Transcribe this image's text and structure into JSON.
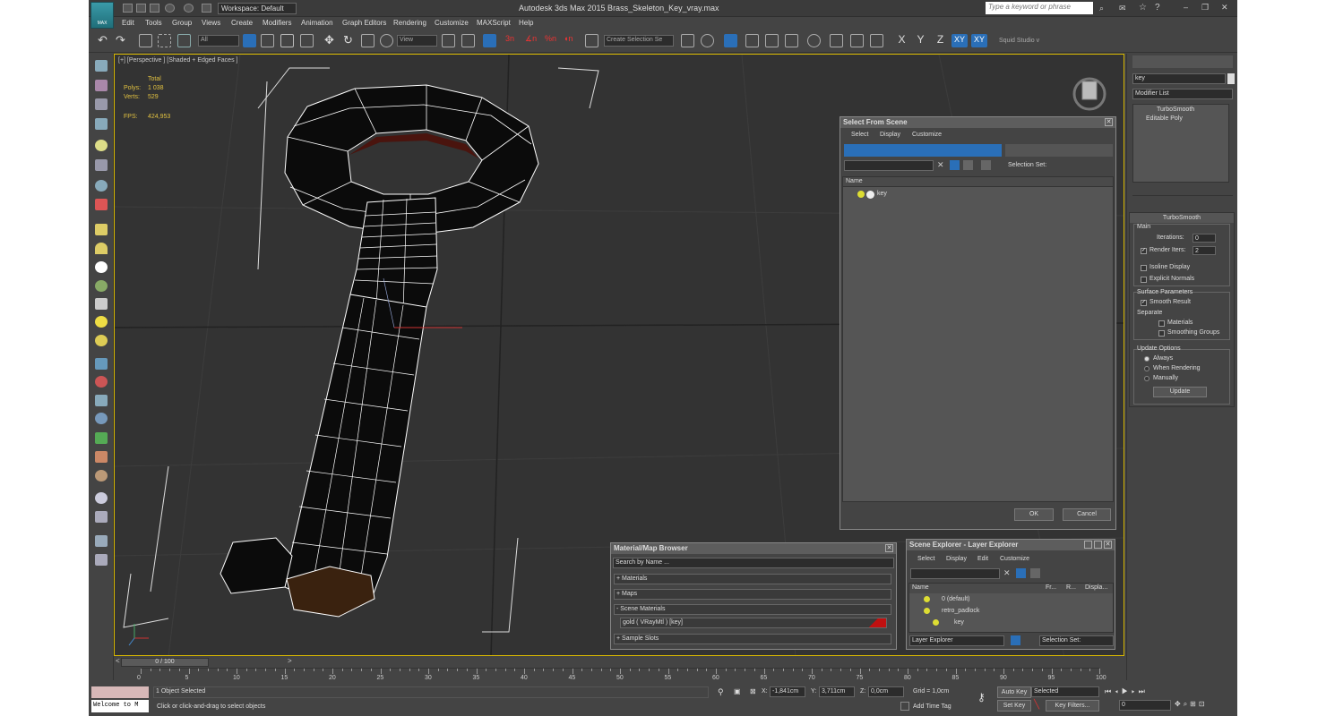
{
  "app": {
    "logo_label": "MAX",
    "workspace": "Workspace: Default",
    "title": "Autodesk 3ds Max  2015      Brass_Skeleton_Key_vray.max",
    "search_placeholder": "Type a keyword or phrase"
  },
  "menu": [
    "Edit",
    "Tools",
    "Group",
    "Views",
    "Create",
    "Modifiers",
    "Animation",
    "Graph Editors",
    "Rendering",
    "Customize",
    "MAXScript",
    "Help"
  ],
  "toolbar": {
    "filter": "All",
    "ref_coord": "View",
    "selection_set": "Create Selection Se",
    "axes": [
      "X",
      "Y",
      "Z",
      "XY",
      "XY"
    ],
    "studio": "Squid Studio v"
  },
  "viewport": {
    "label": "[+] [Perspective ] [Shaded + Edged Faces ]",
    "stats_total": "Total",
    "polys_label": "Polys:",
    "polys": "1 038",
    "verts_label": "Verts:",
    "verts": "529",
    "fps_label": "FPS:",
    "fps": "424,953"
  },
  "select_from_scene": {
    "title": "Select From Scene",
    "menu": [
      "Select",
      "Display",
      "Customize"
    ],
    "selection_sets": "Selection Set:",
    "col_name": "Name",
    "item": "key",
    "ok": "OK",
    "cancel": "Cancel"
  },
  "material_browser": {
    "title": "Material/Map Browser",
    "search": "Search by Name ...",
    "sections": [
      "+ Materials",
      "+ Maps",
      "- Scene Materials"
    ],
    "material": "gold  ( VRayMtl ) [key]",
    "sample": "+ Sample Slots"
  },
  "scene_explorer": {
    "title": "Scene Explorer - Layer Explorer",
    "menu": [
      "Select",
      "Display",
      "Edit",
      "Customize"
    ],
    "columns": [
      "Name",
      "Fr...",
      "R...",
      "Displa..."
    ],
    "rows": [
      "0 (default)",
      "retro_padlock",
      "key"
    ],
    "footer_left": "Layer Explorer",
    "footer_right": "Selection Set:"
  },
  "command_panel": {
    "object_name": "key",
    "modifier_list": "Modifier List",
    "stack": [
      "TurboSmooth",
      "Editable Poly"
    ],
    "rollout": "TurboSmooth",
    "main": "Main",
    "iterations_label": "Iterations:",
    "iterations": "0",
    "render_iters_label": "Render Iters:",
    "render_iters": "2",
    "isoline": "Isoline Display",
    "explicit": "Explicit Normals",
    "surface_params": "Surface Parameters",
    "smooth_result": "Smooth Result",
    "separate": "Separate",
    "materials": "Materials",
    "smoothing_groups": "Smoothing Groups",
    "update_options": "Update Options",
    "always": "Always",
    "when_rendering": "When Rendering",
    "manually": "Manually",
    "update": "Update"
  },
  "timeline": {
    "frame": "0 / 100",
    "ticks": [
      "0",
      "5",
      "10",
      "15",
      "20",
      "25",
      "30",
      "35",
      "40",
      "45",
      "50",
      "55",
      "60",
      "65",
      "70",
      "75",
      "80",
      "85",
      "90",
      "95",
      "100"
    ]
  },
  "status": {
    "welcome": "Welcome to M",
    "selected": "1 Object Selected",
    "prompt": "Click or click-and-drag to select objects",
    "x_label": "X:",
    "x": "-1,841cm",
    "y_label": "Y:",
    "y": "3,711cm",
    "z_label": "Z:",
    "z": "0,0cm",
    "grid": "Grid = 1,0cm",
    "add_time_tag": "Add Time Tag",
    "auto_key": "Auto Key",
    "set_key": "Set Key",
    "selected_dd": "Selected",
    "key_filters": "Key Filters...",
    "frame_field": "0"
  },
  "colors": {
    "accent": "#d8b800",
    "selected_blue": "#2a6fb8"
  }
}
